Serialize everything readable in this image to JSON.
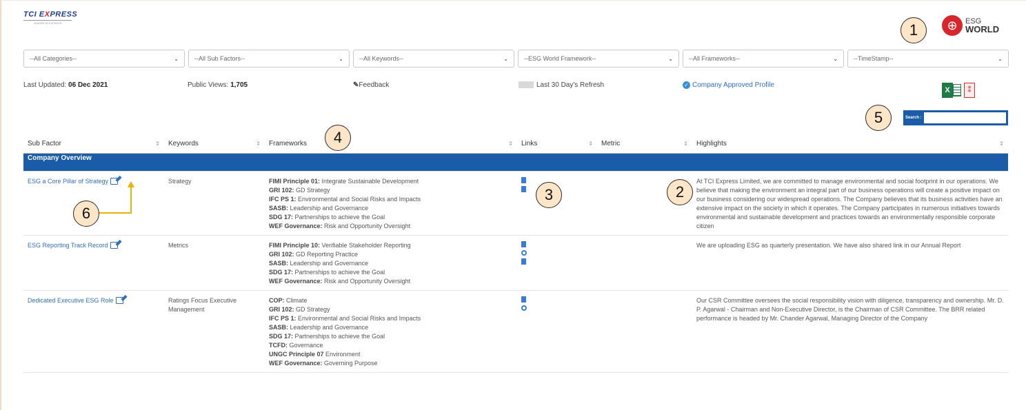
{
  "brand": {
    "name_a": "TCI E",
    "name_x": "X",
    "name_b": "PRESS",
    "tagline": "LEADER IN EXPRESS"
  },
  "logo": {
    "line1": "ESG",
    "line2": "WORLD"
  },
  "callouts": [
    "1",
    "2",
    "3",
    "4",
    "5",
    "6"
  ],
  "filters": [
    {
      "value": "--All Categories--"
    },
    {
      "value": "--All Sub Factors--"
    },
    {
      "value": "--All Keywords--"
    },
    {
      "value": "--ESG World Framework--"
    },
    {
      "value": "--All Frameworks--"
    },
    {
      "value": "--TimeStamp--"
    }
  ],
  "info": {
    "last_updated_label": "Last Updated:",
    "last_updated_value": "06 Dec 2021",
    "public_views_label": "Public Views:",
    "public_views_value": "1,705",
    "feedback": "Feedback",
    "refresh": "Last 30 Day's Refresh",
    "approved": "Company Approved Profile"
  },
  "search": {
    "label": "Search :",
    "value": ""
  },
  "table": {
    "headers": [
      "Sub Factor",
      "Keywords",
      "Frameworks",
      "Links",
      "Metric",
      "Highlights"
    ],
    "group": "Company Overview",
    "rows": [
      {
        "sub": "ESG a Core Pillar of Strategy",
        "keyword": "Strategy",
        "frameworks": [
          {
            "b": "FIMI Principle 01:",
            "t": " Integrate Sustainable Development"
          },
          {
            "b": "GRI 102:",
            "t": " GD Strategy"
          },
          {
            "b": "IFC PS 1:",
            "t": " Environmental and Social Risks and Impacts"
          },
          {
            "b": "SASB:",
            "t": " Leadership and Governance"
          },
          {
            "b": "SDG 17:",
            "t": " Partnerships to achieve the Goal"
          },
          {
            "b": "WEF Governance:",
            "t": " Risk and Opportunity Oversight"
          }
        ],
        "highlights": "At TCI Express Limited, we are committed to manage environmental and social footprint in our operations. We believe that making the environment an integral part of our business operations will create a positive impact on our business considering our widespread operations. The Company believes that its business activities have an extensive impact on the society in which it operates. The Company participates in numerous initiatives towards environmental and sustainable development and practices towards an environmentally responsible corporate citizen"
      },
      {
        "sub": "ESG Reporting Track Record",
        "keyword": "Metrics",
        "frameworks": [
          {
            "b": "FIMI Principle 10:",
            "t": " Verifiable Stakeholder Reporting"
          },
          {
            "b": "GRI 102:",
            "t": " GD Reporting Practice"
          },
          {
            "b": "SASB:",
            "t": " Leadership and Governance"
          },
          {
            "b": "SDG 17:",
            "t": " Partnerships to achieve the Goal"
          },
          {
            "b": "WEF Governance:",
            "t": " Risk and Opportunity Oversight"
          }
        ],
        "highlights": "We are uploading ESG as quarterly presentation. We have also shared link in our Annual Report"
      },
      {
        "sub": "Dedicated Executive ESG Role",
        "keyword": "Ratings Focus Executive Management",
        "frameworks": [
          {
            "b": "COP:",
            "t": " Climate"
          },
          {
            "b": "GRI 102:",
            "t": " GD Strategy"
          },
          {
            "b": "IFC PS 1:",
            "t": " Environmental and Social Risks and Impacts"
          },
          {
            "b": "SASB:",
            "t": " Leadership and Governance"
          },
          {
            "b": "SDG 17:",
            "t": " Partnerships to achieve the Goal"
          },
          {
            "b": "TCFD:",
            "t": " Governance"
          },
          {
            "b": "UNGC Principle 07",
            "t": " Environment"
          },
          {
            "b": "WEF Governance:",
            "t": " Governing Purpose"
          }
        ],
        "highlights": "Our CSR Committee oversees the social responsibility vision with diligence, transparency and ownership. Mr. D. P. Agarwal - Chairman and Non-Executive Director, is the Chairman of CSR Committee. The BRR related performance is headed by Mr. Chander Agarwal, Managing Director of the Company"
      }
    ]
  }
}
